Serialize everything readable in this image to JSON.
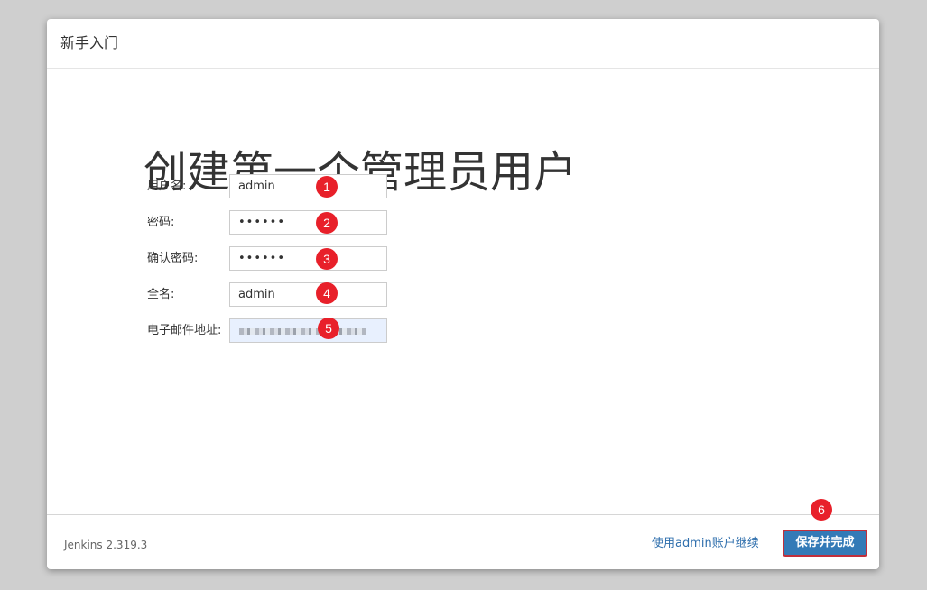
{
  "dialog": {
    "title": "新手入门"
  },
  "main": {
    "heading": "创建第一个管理员用户",
    "fields": {
      "username": {
        "label": "用户名:",
        "value": "admin",
        "marker": "1"
      },
      "password": {
        "label": "密码:",
        "value": "••••••",
        "marker": "2"
      },
      "confirm_password": {
        "label": "确认密码:",
        "value": "••••••",
        "marker": "3"
      },
      "fullname": {
        "label": "全名:",
        "value": "admin",
        "marker": "4"
      },
      "email": {
        "label": "电子邮件地址:",
        "marker": "5"
      }
    }
  },
  "footer": {
    "version": "Jenkins 2.319.3",
    "skip_label": "使用admin账户继续",
    "save_label": "保存并完成",
    "save_marker": "6"
  },
  "colors": {
    "primary_button": "#337ab7",
    "link": "#2f6fad",
    "marker": "#e8202a",
    "highlight_border": "#c12f3b",
    "autofill_bg": "#e8f0fe"
  }
}
